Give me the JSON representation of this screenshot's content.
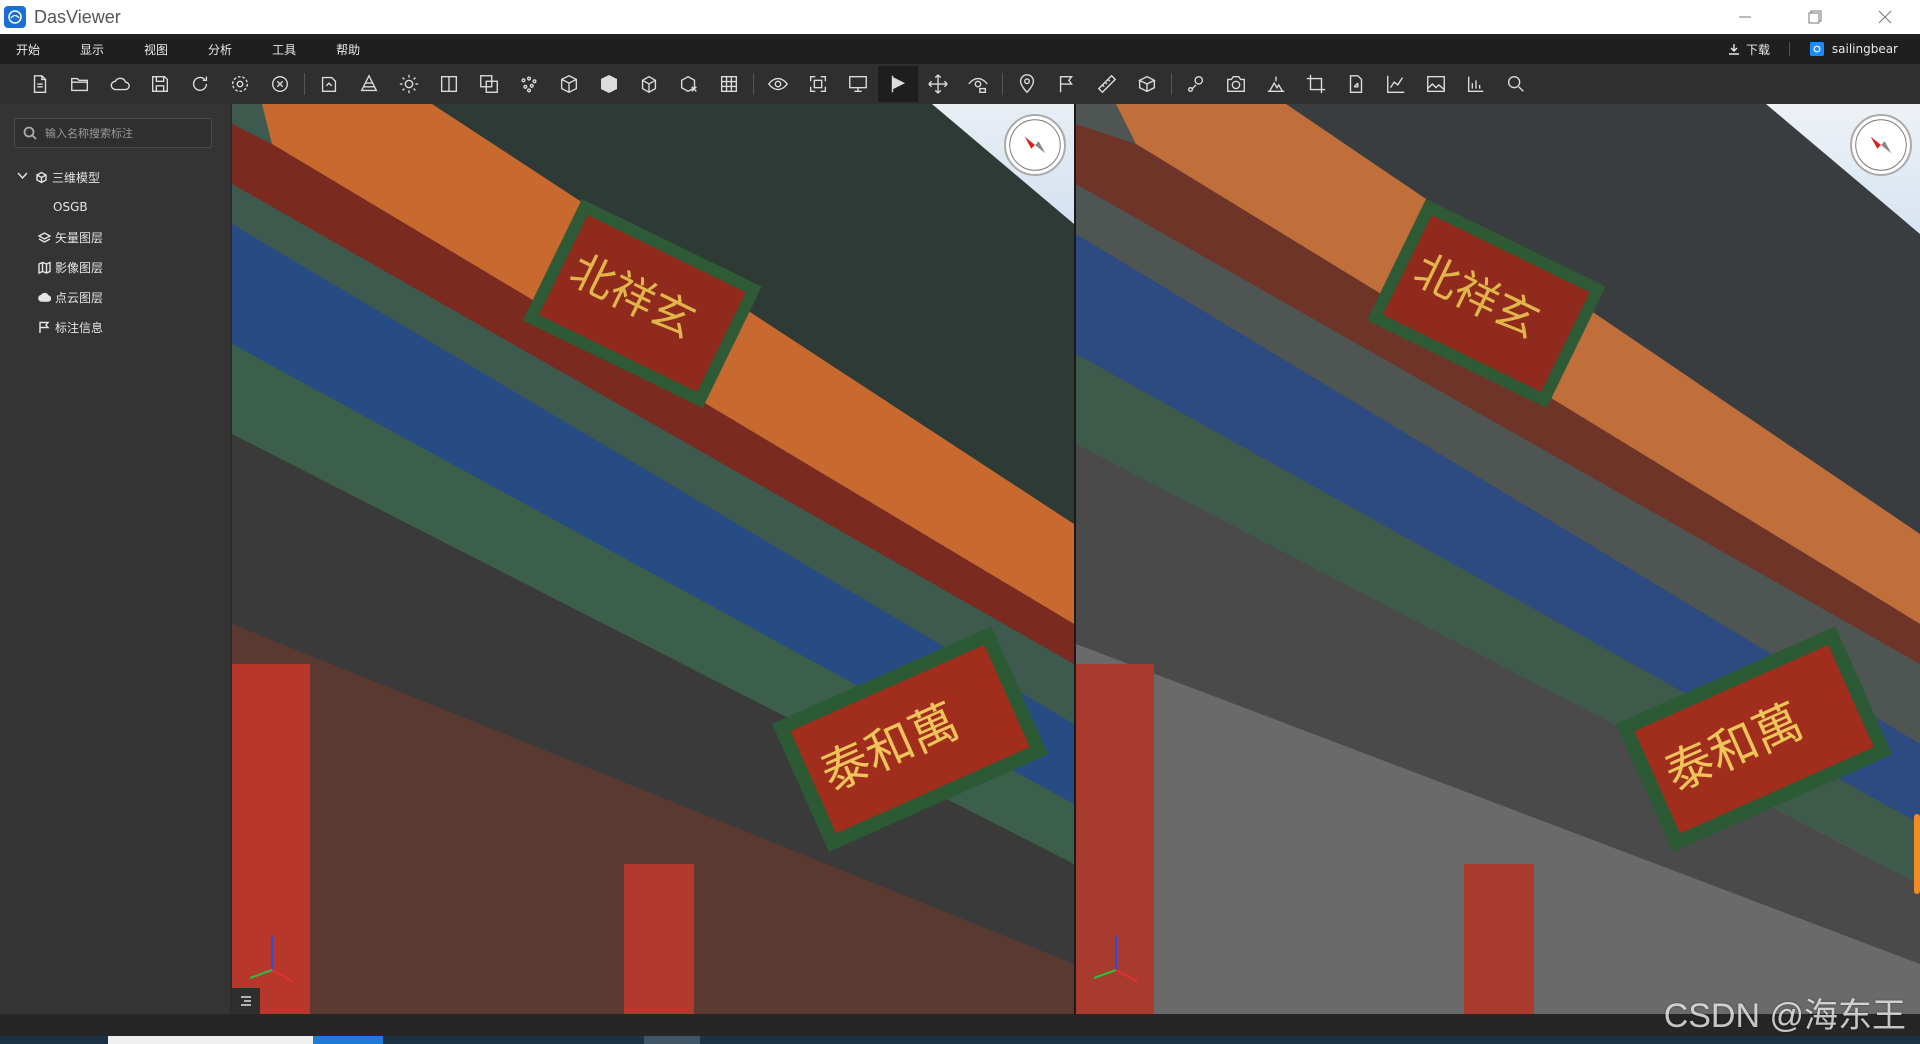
{
  "window": {
    "title": "DasViewer"
  },
  "menubar": {
    "items": [
      "开始",
      "显示",
      "视图",
      "分析",
      "工具",
      "帮助"
    ],
    "download_label": "下载",
    "username": "sailingbear"
  },
  "toolbar": {
    "icons": [
      "new-file-icon",
      "open-folder-icon",
      "cloud-icon",
      "save-icon",
      "refresh-icon",
      "settings-icon",
      "close-circle-icon",
      "import-model-icon",
      "pyramid-icon",
      "lighting-icon",
      "split-view-icon",
      "overlay-icon",
      "point-cloud-icon",
      "wireframe-icon",
      "solid-icon",
      "box-icon",
      "clip-box-icon",
      "grid-icon",
      "observe-icon",
      "fullscreen-icon",
      "screen-icon",
      "pick-icon",
      "move-icon",
      "orbit-icon",
      "marker-icon",
      "flag-icon",
      "ruler-icon",
      "volume-icon",
      "route-icon",
      "camera-icon",
      "terrain-icon",
      "crop-icon",
      "export-icon",
      "chart-icon",
      "image-icon",
      "report-icon",
      "search-icon"
    ],
    "active_index": 21
  },
  "sidebar": {
    "search_placeholder": "输入名称搜索标注",
    "tree": [
      {
        "label": "三维模型",
        "icon": "cube-icon",
        "expanded": true,
        "level": 0
      },
      {
        "label": "OSGB",
        "icon": "",
        "level": 1
      },
      {
        "label": "矢量图层",
        "icon": "layers-icon",
        "level": 0
      },
      {
        "label": "影像图层",
        "icon": "map-icon",
        "level": 0
      },
      {
        "label": "点云图层",
        "icon": "cloud-layer-icon",
        "level": 0
      },
      {
        "label": "标注信息",
        "icon": "flag-icon",
        "level": 0
      }
    ]
  },
  "colors": {
    "titlebar_bg": "#ffffff",
    "menubar_bg": "#1f1f1f",
    "toolbar_bg": "#2f2f2f",
    "sidebar_bg": "#343434",
    "accent": "#1a6fd6",
    "scroll_indicator": "#f08a24"
  },
  "watermark": "CSDN @海东王"
}
